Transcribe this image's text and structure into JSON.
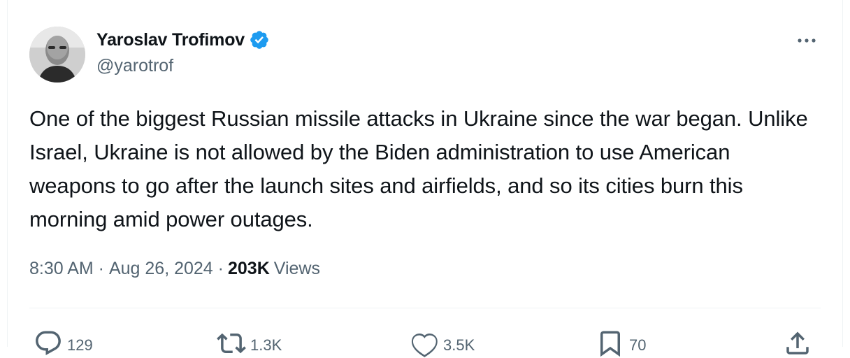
{
  "author": {
    "name": "Yaroslav Trofimov",
    "handle": "@yarotrof"
  },
  "tweet": {
    "text": "One of the biggest Russian missile attacks in Ukraine since the war began. Unlike Israel, Ukraine is not allowed by the Biden administration to use American weapons to go after the launch sites and airfields, and so its cities burn this morning amid power outages."
  },
  "meta": {
    "time": "8:30 AM",
    "date": "Aug 26, 2024",
    "views_count": "203K",
    "views_label": "Views"
  },
  "actions": {
    "replies": "129",
    "reposts": "1.3K",
    "likes": "3.5K",
    "bookmarks": "70"
  },
  "icons": [
    "verified-badge-icon",
    "more-options-icon",
    "reply-icon",
    "repost-icon",
    "like-icon",
    "bookmark-icon",
    "share-icon"
  ],
  "colors": {
    "verified": "#1d9bf0",
    "text": "#0f1419",
    "secondary": "#536471",
    "divider": "#eff3f4"
  }
}
